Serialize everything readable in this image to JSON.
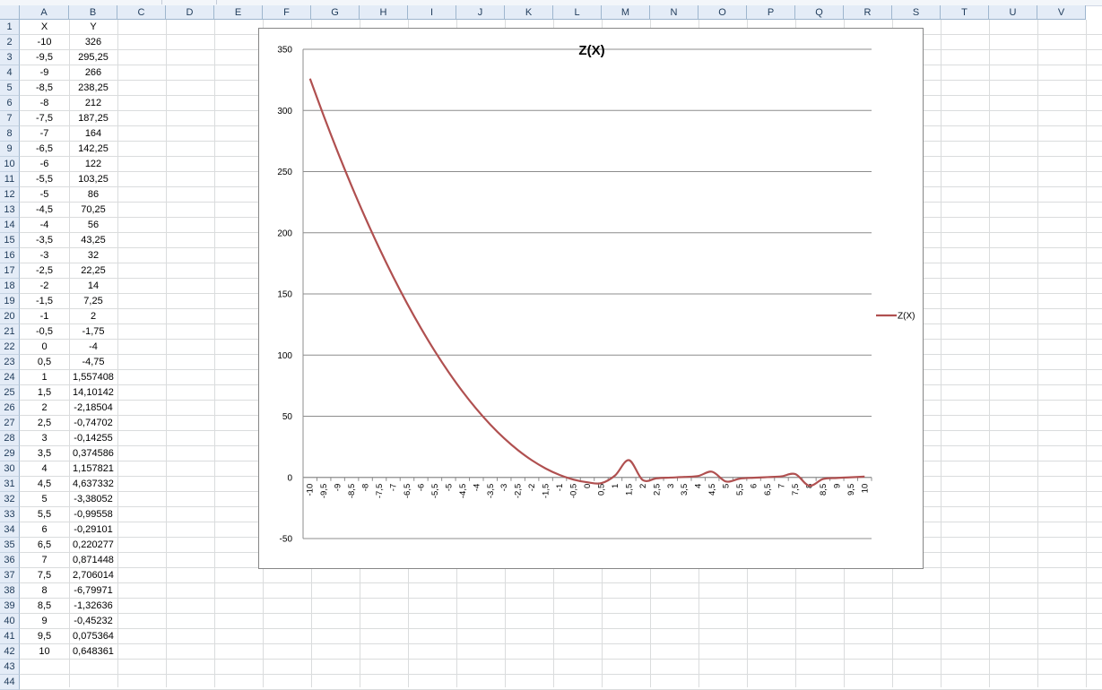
{
  "columns": [
    "A",
    "B",
    "C",
    "D",
    "E",
    "F",
    "G",
    "H",
    "I",
    "J",
    "K",
    "L",
    "M",
    "N",
    "O",
    "P",
    "Q",
    "R",
    "S",
    "T",
    "U",
    "V"
  ],
  "rows": [
    "1",
    "2",
    "3",
    "4",
    "5",
    "6",
    "7",
    "8",
    "9",
    "10",
    "11",
    "12",
    "13",
    "14",
    "15",
    "16",
    "17",
    "18",
    "19",
    "20",
    "21",
    "22",
    "23",
    "24",
    "25",
    "26",
    "27",
    "28",
    "29",
    "30",
    "31",
    "32",
    "33",
    "34",
    "35",
    "36",
    "37",
    "38",
    "39",
    "40",
    "41",
    "42",
    "43",
    "44"
  ],
  "table": {
    "header": [
      "X",
      "Y"
    ],
    "x_values": [
      "-10",
      "-9,5",
      "-9",
      "-8,5",
      "-8",
      "-7,5",
      "-7",
      "-6,5",
      "-6",
      "-5,5",
      "-5",
      "-4,5",
      "-4",
      "-3,5",
      "-3",
      "-2,5",
      "-2",
      "-1,5",
      "-1",
      "-0,5",
      "0",
      "0,5",
      "1",
      "1,5",
      "2",
      "2,5",
      "3",
      "3,5",
      "4",
      "4,5",
      "5",
      "5,5",
      "6",
      "6,5",
      "7",
      "7,5",
      "8",
      "8,5",
      "9",
      "9,5",
      "10"
    ],
    "y_values": [
      "326",
      "295,25",
      "266",
      "238,25",
      "212",
      "187,25",
      "164",
      "142,25",
      "122",
      "103,25",
      "86",
      "70,25",
      "56",
      "43,25",
      "32",
      "22,25",
      "14",
      "7,25",
      "2",
      "-1,75",
      "-4",
      "-4,75",
      "1,557408",
      "14,10142",
      "-2,18504",
      "-0,74702",
      "-0,14255",
      "0,374586",
      "1,157821",
      "4,637332",
      "-3,38052",
      "-0,99558",
      "-0,29101",
      "0,220277",
      "0,871448",
      "2,706014",
      "-6,79971",
      "-1,32636",
      "-0,45232",
      "0,075364",
      "0,648361"
    ]
  },
  "chart_data": {
    "type": "line",
    "title": "Z(X)",
    "series": [
      {
        "name": "Z(X)",
        "color": "#b05050",
        "x": [
          -10,
          -9.5,
          -9,
          -8.5,
          -8,
          -7.5,
          -7,
          -6.5,
          -6,
          -5.5,
          -5,
          -4.5,
          -4,
          -3.5,
          -3,
          -2.5,
          -2,
          -1.5,
          -1,
          -0.5,
          0,
          0.5,
          1,
          1.5,
          2,
          2.5,
          3,
          3.5,
          4,
          4.5,
          5,
          5.5,
          6,
          6.5,
          7,
          7.5,
          8,
          8.5,
          9,
          9.5,
          10
        ],
        "values": [
          326,
          295.25,
          266,
          238.25,
          212,
          187.25,
          164,
          142.25,
          122,
          103.25,
          86,
          70.25,
          56,
          43.25,
          32,
          22.25,
          14,
          7.25,
          2,
          -1.75,
          -4,
          -4.75,
          1.557408,
          14.10142,
          -2.18504,
          -0.74702,
          -0.14255,
          0.374586,
          1.157821,
          4.637332,
          -3.38052,
          -0.99558,
          -0.29101,
          0.220277,
          0.871448,
          2.706014,
          -6.79971,
          -1.32636,
          -0.45232,
          0.075364,
          0.648361
        ]
      }
    ],
    "categories": [
      "-10",
      "-9,5",
      "-9",
      "-8,5",
      "-8",
      "-7,5",
      "-7",
      "-6,5",
      "-6",
      "-5,5",
      "-5",
      "-4,5",
      "-4",
      "-3,5",
      "-3",
      "-2,5",
      "-2",
      "-1,5",
      "-1",
      "-0,5",
      "0",
      "0,5",
      "1",
      "1,5",
      "2",
      "2,5",
      "3",
      "3,5",
      "4",
      "4,5",
      "5",
      "5,5",
      "6",
      "6,5",
      "7",
      "7,5",
      "8",
      "8,5",
      "9",
      "9,5",
      "10"
    ],
    "yticks": [
      "350",
      "300",
      "250",
      "200",
      "150",
      "100",
      "50",
      "0",
      "-50"
    ],
    "ylim": [
      -50,
      350
    ],
    "grid": true,
    "legend": "right",
    "smooth": true
  }
}
